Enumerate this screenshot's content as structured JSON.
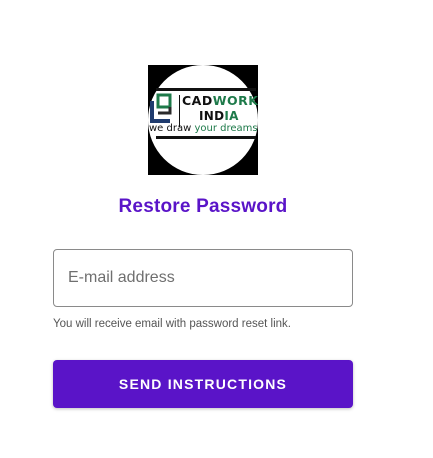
{
  "logo": {
    "brand": "CADWORKS",
    "brand_prefix": "CAD",
    "brand_suffix": "WORKS",
    "sub": "INDIA",
    "sub_prefix": "IND",
    "sub_suffix": "IA",
    "tag_prefix": "we draw",
    "tag_suffix": "your dreams"
  },
  "title": "Restore Password",
  "email": {
    "placeholder": "E-mail address",
    "value": ""
  },
  "helper": "You will receive email with password reset link.",
  "button_label": "SEND INSTRUCTIONS",
  "colors": {
    "accent": "#5a14c8",
    "logo_green": "#1e7a4a"
  }
}
